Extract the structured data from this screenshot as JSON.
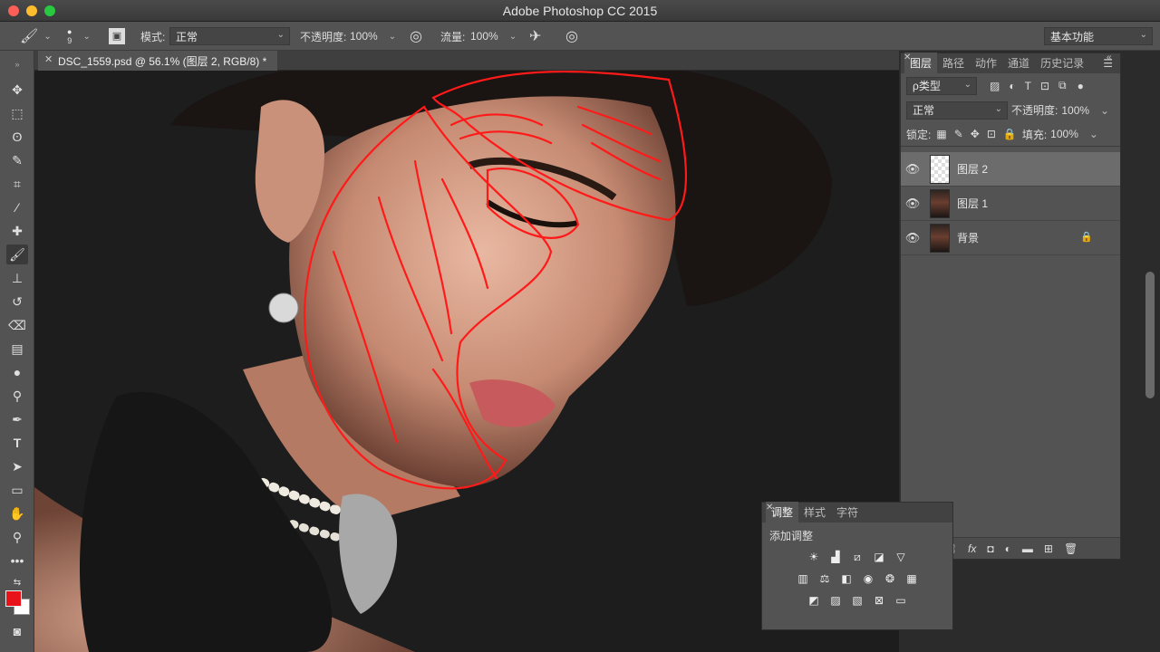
{
  "window": {
    "title": "Adobe Photoshop CC 2015"
  },
  "options_bar": {
    "brush_size": "9",
    "mode_label": "模式:",
    "mode_value": "正常",
    "opacity_label": "不透明度:",
    "opacity_value": "100%",
    "flow_label": "流量:",
    "flow_value": "100%",
    "workspace_value": "基本功能"
  },
  "document": {
    "tab_title": "DSC_1559.psd @ 56.1% (图层 2, RGB/8) *"
  },
  "layers_panel": {
    "tabs": [
      "图层",
      "路径",
      "动作",
      "通道",
      "历史记录"
    ],
    "filter_label": "ρ类型",
    "blend_mode": "正常",
    "opacity_label": "不透明度:",
    "opacity_value": "100%",
    "lock_label": "锁定:",
    "fill_label": "填充:",
    "fill_value": "100%",
    "layers": [
      {
        "name": "图层 2",
        "selected": true
      },
      {
        "name": "图层 1",
        "selected": false
      },
      {
        "name": "背景",
        "selected": false,
        "locked": true
      }
    ],
    "footer_icons": [
      "link-icon",
      "fx-icon",
      "mask-icon",
      "adjustment-icon",
      "folder-icon",
      "new-layer-icon",
      "trash-icon"
    ],
    "fx_label": "fx"
  },
  "adjustments_panel": {
    "tabs": [
      "调整",
      "样式",
      "字符"
    ],
    "heading": "添加调整"
  },
  "colors": {
    "foreground": "#e8121a",
    "background": "#ffffff",
    "stroke": "#ff1a1a"
  }
}
